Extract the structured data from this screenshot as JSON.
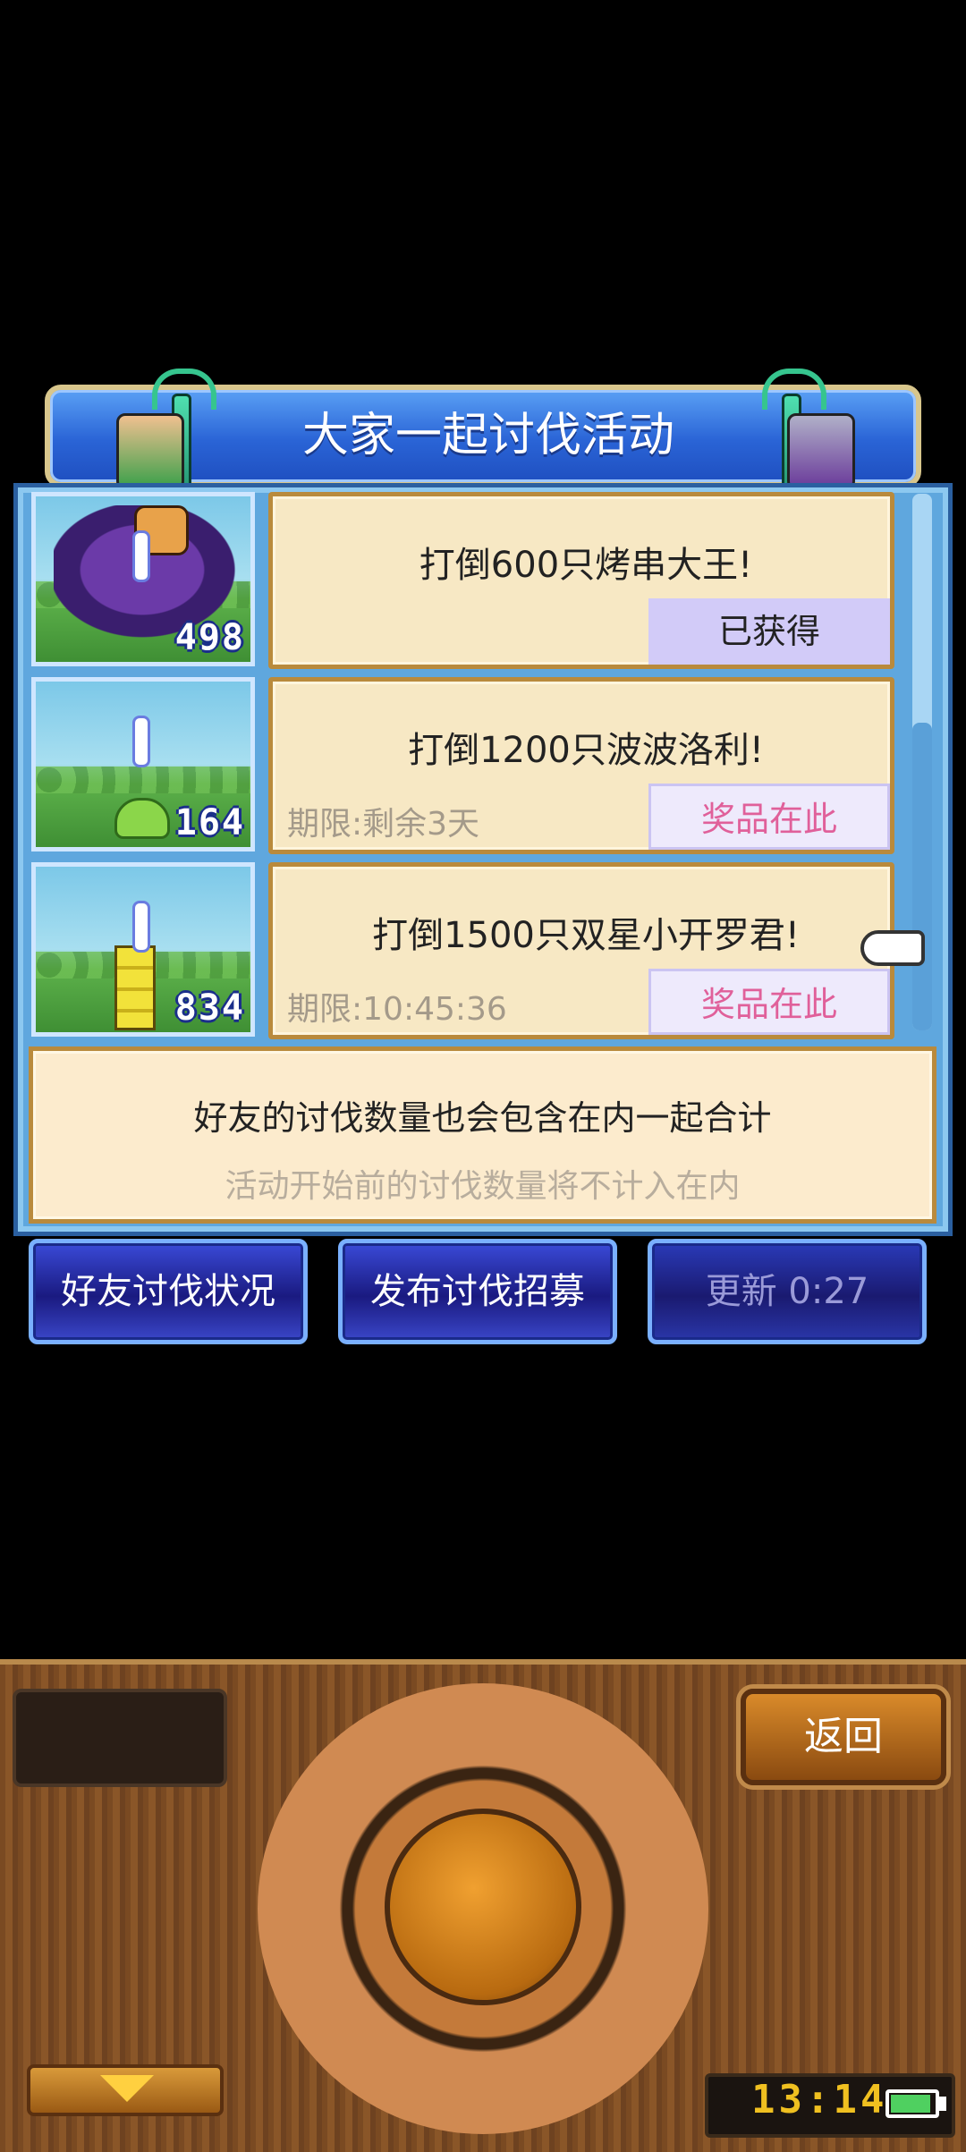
{
  "banner": {
    "title": "大家一起讨伐活动"
  },
  "quests": [
    {
      "title": "打倒600只烤串大王!",
      "deadline": "",
      "reward_label": "已获得",
      "count": "498"
    },
    {
      "title": "打倒1200只波波洛利!",
      "deadline": "期限:剩余3天",
      "reward_label": "奖品在此",
      "count": "164"
    },
    {
      "title": "打倒1500只双星小开罗君!",
      "deadline": "期限:10:45:36",
      "reward_label": "奖品在此",
      "count": "834"
    }
  ],
  "note": {
    "main": "好友的讨伐数量也会包含在内一起合计",
    "sub": "活动开始前的讨伐数量将不计入在内"
  },
  "buttons": {
    "friend_status": "好友讨伐状况",
    "post_recruit": "发布讨伐招募",
    "refresh": "更新 0:27"
  },
  "device": {
    "back_label": "返回",
    "clock": "13:14"
  },
  "colors": {
    "accent_blue": "#2a64d6",
    "card_bg": "#f7e8c4",
    "reward_text": "#e0609a"
  }
}
